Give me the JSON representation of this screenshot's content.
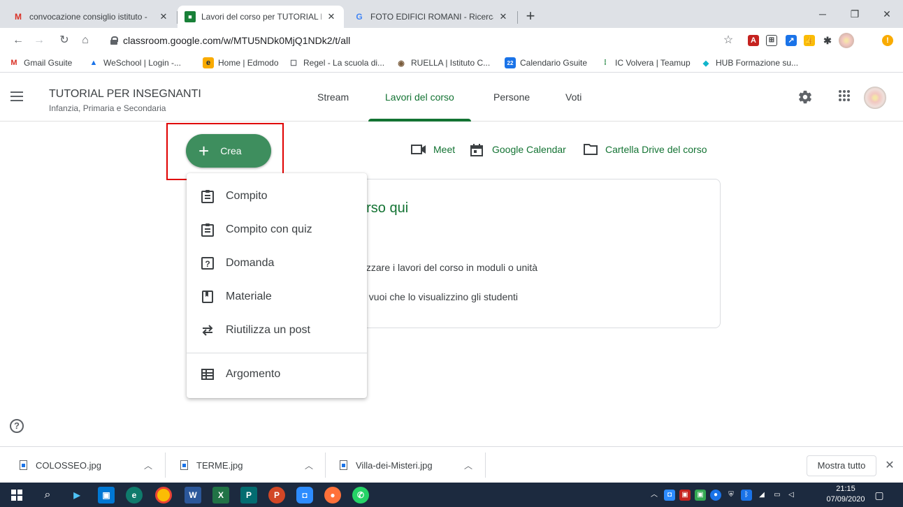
{
  "browser": {
    "tabs": [
      {
        "title": "convocazione consiglio istituto -",
        "favicon": "M",
        "close": "✕"
      },
      {
        "title": "Lavori del corso per TUTORIAL PER",
        "favicon": "■",
        "close": "✕"
      },
      {
        "title": "FOTO EDIFICI ROMANI - Ricerca",
        "favicon": "G",
        "close": "✕"
      }
    ],
    "new_tab": "+",
    "window_controls": {
      "minimize": "─",
      "restore": "❐",
      "close": "✕"
    },
    "url": "classroom.google.com/w/MTU5NDk0MjQ1NDk2/t/all",
    "bookmarks": [
      {
        "label": "Gmail Gsuite",
        "icon": "M"
      },
      {
        "label": "WeSchool | Login -...",
        "icon": "▲"
      },
      {
        "label": "Home | Edmodo",
        "icon": "e"
      },
      {
        "label": "Regel - La scuola di...",
        "icon": "☐"
      },
      {
        "label": "RUELLA | Istituto C...",
        "icon": "◉"
      },
      {
        "label": "Calendario Gsuite",
        "icon": "22"
      },
      {
        "label": "IC Volvera | Teamup",
        "icon": "⁞"
      },
      {
        "label": "HUB Formazione su...",
        "icon": "◆"
      }
    ]
  },
  "classroom": {
    "course_title": "TUTORIAL PER INSEGNANTI",
    "course_subtitle": "Infanzia, Primaria e Secondaria",
    "nav_tabs": [
      "Stream",
      "Lavori del corso",
      "Persone",
      "Voti"
    ],
    "active_tab": "Lavori del corso",
    "create_button": "Crea",
    "top_links": [
      "Meet",
      "Google Calendar",
      "Cartella Drive del corso"
    ],
    "empty_state": {
      "heading": "orso qui",
      "line1": "nizzare i lavori del corso in moduli o unità",
      "line2": "ui vuoi che lo visualizzino gli studenti"
    },
    "create_menu": [
      {
        "label": "Compito",
        "icon": "assignment-icon"
      },
      {
        "label": "Compito con quiz",
        "icon": "quiz-assignment-icon"
      },
      {
        "label": "Domanda",
        "icon": "question-icon"
      },
      {
        "label": "Materiale",
        "icon": "material-icon"
      },
      {
        "label": "Riutilizza un post",
        "icon": "reuse-icon"
      },
      {
        "label": "Argomento",
        "icon": "topic-icon"
      }
    ],
    "help": "?"
  },
  "downloads": {
    "files": [
      "COLOSSEO.jpg",
      "TERME.jpg",
      "Villa-dei-Misteri.jpg"
    ],
    "show_all": "Mostra tutto",
    "close": "✕"
  },
  "taskbar": {
    "time": "21:15",
    "date": "07/09/2020"
  },
  "colors": {
    "accent_green": "#137333",
    "create_button": "#3e8e5e",
    "highlight_red": "#e00000",
    "taskbar": "#1c2a3f"
  }
}
